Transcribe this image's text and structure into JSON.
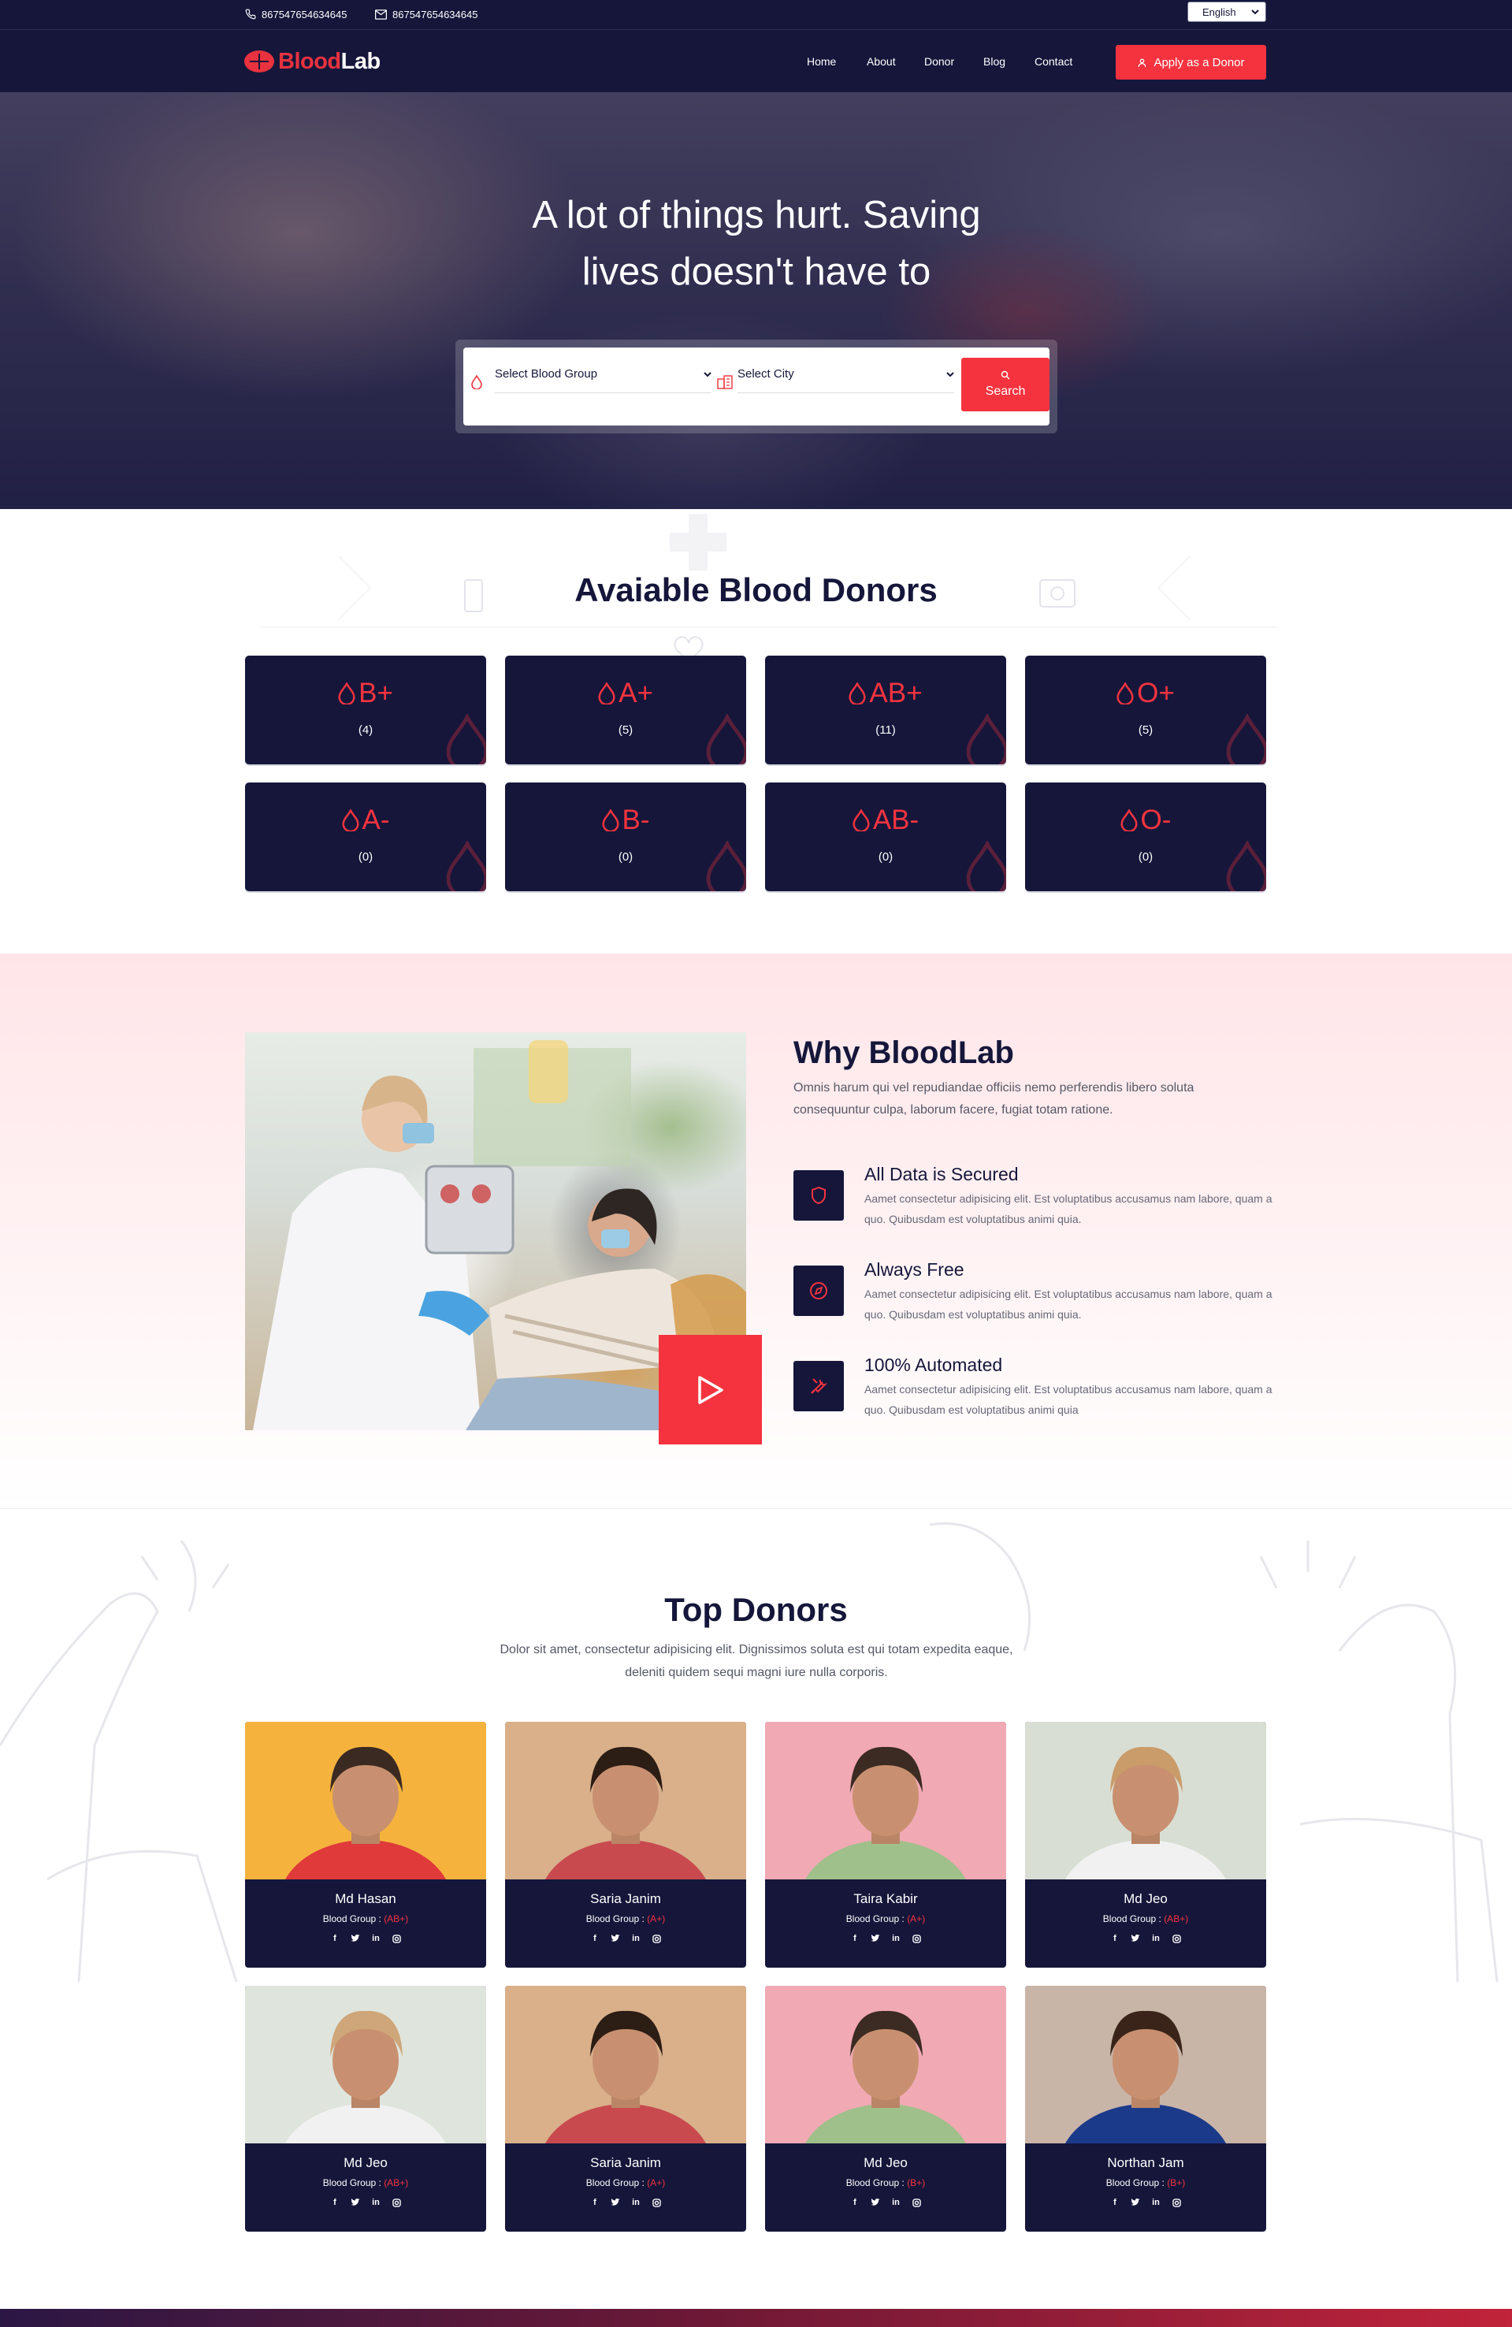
{
  "topbar": {
    "phone": "867547654634645",
    "email": "867547654634645",
    "language": "English"
  },
  "nav": {
    "logo_part1": "Blood",
    "logo_part2": "Lab",
    "links": [
      "Home",
      "About",
      "Donor",
      "Blog",
      "Contact"
    ],
    "apply_label": "Apply as a Donor"
  },
  "hero": {
    "title_line1": "A lot of things hurt. Saving",
    "title_line2": "lives doesn't have to",
    "blood_group_placeholder": "Select Blood Group",
    "city_placeholder": "Select City",
    "search_label": "Search"
  },
  "available": {
    "title": "Avaiable Blood Donors",
    "groups": [
      {
        "type": "B+",
        "count": "(4)"
      },
      {
        "type": "A+",
        "count": "(5)"
      },
      {
        "type": "AB+",
        "count": "(11)"
      },
      {
        "type": "O+",
        "count": "(5)"
      },
      {
        "type": "A-",
        "count": "(0)"
      },
      {
        "type": "B-",
        "count": "(0)"
      },
      {
        "type": "AB-",
        "count": "(0)"
      },
      {
        "type": "O-",
        "count": "(0)"
      }
    ]
  },
  "why": {
    "title": "Why BloodLab",
    "desc": "Omnis harum qui vel repudiandae officiis nemo perferendis libero soluta consequuntur culpa, laborum facere, fugiat totam ratione.",
    "features": [
      {
        "icon": "shield-icon",
        "title": "All Data is Secured",
        "desc": "Aamet consectetur adipisicing elit. Est voluptatibus accusamus nam labore, quam a quo. Quibusdam est voluptatibus animi quia."
      },
      {
        "icon": "compass-icon",
        "title": "Always Free",
        "desc": "Aamet consectetur adipisicing elit. Est voluptatibus accusamus nam labore, quam a quo. Quibusdam est voluptatibus animi quia."
      },
      {
        "icon": "tools-icon",
        "title": "100% Automated",
        "desc": "Aamet consectetur adipisicing elit. Est voluptatibus accusamus nam labore, quam a quo. Quibusdam est voluptatibus animi quia"
      }
    ]
  },
  "top_donors": {
    "title": "Top Donors",
    "desc": "Dolor sit amet, consectetur adipisicing elit. Dignissimos soluta est qui totam expedita eaque, deleniti quidem sequi magni iure nulla corporis.",
    "group_label": "Blood Group : ",
    "donors": [
      {
        "name": "Md Hasan",
        "group": "(AB+)"
      },
      {
        "name": "Saria Janim",
        "group": "(A+)"
      },
      {
        "name": "Taira Kabir",
        "group": "(A+)"
      },
      {
        "name": "Md Jeo",
        "group": "(AB+)"
      },
      {
        "name": "Md Jeo",
        "group": "(AB+)"
      },
      {
        "name": "Saria Janim",
        "group": "(A+)"
      },
      {
        "name": "Md Jeo",
        "group": "(B+)"
      },
      {
        "name": "Northan Jam",
        "group": "(B+)"
      }
    ]
  },
  "colors": {
    "navy": "#15163a",
    "accent": "#f5333f",
    "pink_bg": "#ffe5e8"
  }
}
